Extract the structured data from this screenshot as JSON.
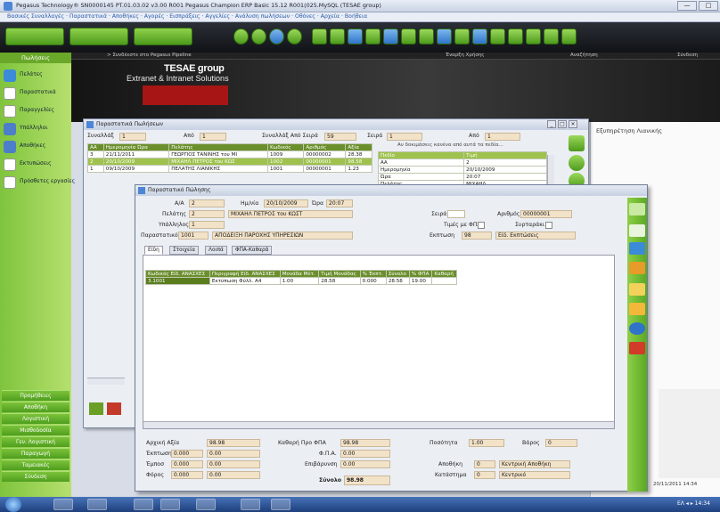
{
  "titlebar": {
    "title": "Pegasus Technology® SN0000145 PT.01.03.02 v3.00 R001 Pegasus Champion ERP Basic 15.12 R001(025.MySQL (TESAE group)",
    "min": "—",
    "max": "□",
    "close": "×"
  },
  "menubar": {
    "text": "Βασικές Συναλλαγές · Παραστατικά · Αποθήκες · Αγορές · Εισπράξεις · Αγγελίες · Ανάλυση πωλήσεων · Οθόνες · Αρχεία · Βοήθεια"
  },
  "banner": {
    "path": "> Συνδέεστε στο Pegasus Pipeline",
    "f1": "Έναρξη Χρήσης",
    "f2": "Αναζήτηση",
    "f3": "Σύνδεση",
    "logo1": "TESAE group",
    "logo2": "Extranet & Intranet Solutions"
  },
  "sidebar": {
    "header": "Πωλήσεις",
    "items": [
      {
        "label": "Πελάτες",
        "color": "#3c8bd8"
      },
      {
        "label": "Παραστατικά",
        "color": "#ffffff"
      },
      {
        "label": "Παραγγελίες",
        "color": "#ffffff"
      },
      {
        "label": "Υπάλληλοι",
        "color": "#4c7ec9"
      },
      {
        "label": "Αποθήκες",
        "color": "#4c7ec9"
      },
      {
        "label": "Εκτυπώσεις",
        "color": "#ffffff"
      },
      {
        "label": "Πρόσθετες εργασίες",
        "color": "#ffffff"
      }
    ],
    "bottom": [
      "Προμήθειες",
      "Αποθήκη",
      "Λογιστική",
      "Μισθοδοσία",
      "Γεν. Λογιστική",
      "Παραγωγή",
      "Ταμειακές",
      "Σύνδεση"
    ]
  },
  "rpanel": {
    "title": "Εξυπηρέτηση Λιανικής",
    "bottom": "20/11/2011 14:34"
  },
  "win1": {
    "title": "Παραστατικά Πωλήσεων",
    "l_from": "Συναλλάξ",
    "v_from": "1",
    "l_to": "Από",
    "v_to": "1",
    "l_mid": "Συναλλάξ Από Σειρά",
    "v_mid": "59",
    "l_series": "Σειρά",
    "v_series": "1",
    "l_apo": "Από",
    "v_apo": "1",
    "hint": "Αν δοκιμάσεις κανένα από αυτά τα πεδία...",
    "headers": [
      "ΑΑ",
      "Ημερομηνία Ώρα",
      "Πελάτης",
      "Κωδικός",
      "Αριθμός",
      "Αξία"
    ],
    "rows": [
      [
        "3",
        "21/11/2011",
        "ΓΕΩΡΓΙΟΣ ΤΑΝΙΝΗΣ του ΜΙ",
        "1009",
        "00000002",
        "28.38"
      ],
      [
        "2",
        "20/10/2009",
        "ΜΙΧΑΗΛ ΠΕΤΡΟΣ του ΚΩΣ",
        "1002",
        "00000001",
        "98.58"
      ],
      [
        "1",
        "09/10/2009",
        "ΠΕΛΑΤΗΣ ΛΙΑΝΙΚΗΣ",
        "1001",
        "00000001",
        "1.23"
      ]
    ],
    "side_headers": [
      "Πεδίο",
      "Τιμή"
    ],
    "side_rows": [
      [
        "ΑΑ",
        "2"
      ],
      [
        "Ημερομηνία",
        "20/10/2009"
      ],
      [
        "Ώρα",
        "20:07"
      ],
      [
        "Πελάτης",
        "ΜΙΧΑΗΛ"
      ]
    ]
  },
  "win2": {
    "title": "Παραστατικό Πώλησης",
    "l_aa": "Α/Α",
    "v_aa": "2",
    "l_date": "Ημ/νία",
    "v_date": "20/10/2009",
    "l_time": "Ώρα",
    "v_time": "20:07",
    "l_cust": "Πελάτης",
    "v_cust_code": "2",
    "v_cust": "ΜΙΧΑΗΛ ΠΕΤΡΟΣ του ΚΩΣΤ",
    "l_emp": "Υπάλληλος",
    "v_emp": "1",
    "l_doc": "Παραστατικό",
    "v_doc_code": "1001",
    "v_doc": "ΑΠΟΔΕΙΞΗ ΠΑΡΟΧΗΣ ΥΠΗΡΕΣΙΩΝ",
    "l_seira": "Σειρά",
    "v_seira": "",
    "l_arith": "Αριθμός",
    "v_arith": "00000001",
    "l_timesfpa": "Τιμές με ΦΠΑ",
    "l_syn": "Συρταράκι",
    "l_pistosi": "Εκπτωση",
    "v_pistosi": "98",
    "v_pistosi2": "Είδ. Εκπτώσεις",
    "tabs": [
      "Είδη",
      "Στοιχεία",
      "Λοιπά",
      "ΦΠΑ-Καθαρά"
    ],
    "headers": [
      "Κωδικός Είδ. ΑΝΑΣΧΕΣ",
      "Περιγραφή Είδ. ΑΝΑΣΧΕΣ",
      "Μονάδα Μέτ.",
      "Τιμή Μονάδας",
      "% Έκπτ.",
      "Σύνολο",
      "% ΦΠΑ",
      "Καθαρή"
    ],
    "row": [
      "3.1001",
      "Εκτύπωση Φύλλ. Α4",
      "1.00",
      "28.58",
      "0.000",
      "28.58",
      "19.00"
    ],
    "footer": {
      "l_axia": "Αρχική Αξία",
      "v_axia": "98.98",
      "l_ekpt": "Έκπτωση",
      "v_ekpt1": "0.000",
      "v_ekpt2": "0.00",
      "l_prom": "Έμποσ",
      "v_prom1": "0.000",
      "v_prom2": "0.00",
      "l_fisi": "Φόρος",
      "v_fisi1": "0.000",
      "v_fisi2": "0.00",
      "l_kath": "Καθαρή Προ ΦΠΑ",
      "v_kath": "98.98",
      "l_fpa": "Φ.Π.Α.",
      "v_fpa": "0.00",
      "l_kataval": "Επιβάρυνση",
      "v_kataval": "0.00",
      "l_total": "Σύνολο",
      "v_total": "98.98",
      "l_posot": "Ποσότητα",
      "v_posot": "1.00",
      "l_varos": "Βάρος",
      "v_varos": "0",
      "l_apothiki": "Αποθήκη",
      "v_apothiki": "0",
      "v_apothiki2": "Κεντρική Αποθήκη",
      "l_katastima": "Κατάστημα",
      "v_katastima": "0",
      "v_katastima2": "Κεντρικό"
    }
  },
  "taskbar": {
    "clock": "ΕΛ ◂ ▸ 14:34"
  }
}
